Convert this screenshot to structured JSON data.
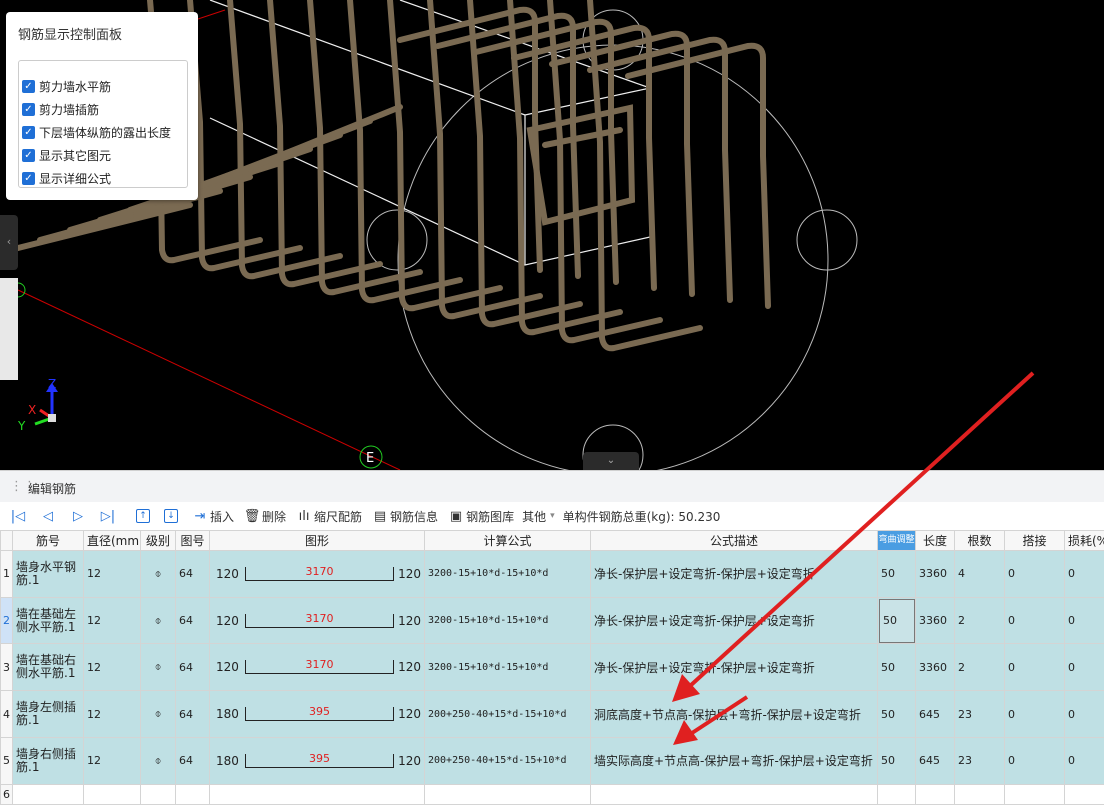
{
  "control_panel": {
    "title": "钢筋显示控制面板",
    "options": [
      {
        "label": "剪力墙水平筋",
        "checked": true
      },
      {
        "label": "剪力墙插筋",
        "checked": true
      },
      {
        "label": "下层墙体纵筋的露出长度",
        "checked": true
      },
      {
        "label": "显示其它图元",
        "checked": true
      },
      {
        "label": "显示详细公式",
        "checked": true
      }
    ]
  },
  "viewport": {
    "axis_z": "Z",
    "axis_x": "X",
    "axis_y": "Y",
    "marker_label": "E"
  },
  "editor": {
    "title": "编辑钢筋"
  },
  "toolbar": {
    "insert": "插入",
    "delete": "删除",
    "scale": "缩尺配筋",
    "rebar_info": "钢筋信息",
    "rebar_lib": "钢筋图库",
    "other": "其他",
    "total_weight": "单构件钢筋总重(kg): 50.230"
  },
  "table": {
    "headers": [
      "筋号",
      "直径(mm)",
      "级别",
      "图号",
      "图形",
      "计算公式",
      "公式描述",
      "弯曲调整",
      "长度",
      "根数",
      "搭接",
      "损耗(%"
    ],
    "highlighted_header": "弯曲调整",
    "rows": [
      {
        "num": "1",
        "name": "墙身水平钢筋.1",
        "dia": "12",
        "grade": "⌽",
        "fig": "64",
        "left": "120",
        "mid": "3170",
        "right": "120",
        "formula": "3200-15+10*d-15+10*d",
        "desc": "净长-保护层+设定弯折-保护层+设定弯折",
        "bend": "50",
        "len": "3360",
        "count": "4",
        "lap": "0",
        "loss": "0"
      },
      {
        "num": "2",
        "name": "墙在基础左侧水平筋.1",
        "dia": "12",
        "grade": "⌽",
        "fig": "64",
        "left": "120",
        "mid": "3170",
        "right": "120",
        "formula": "3200-15+10*d-15+10*d",
        "desc": "净长-保护层+设定弯折-保护层+设定弯折",
        "bend": "50",
        "len": "3360",
        "count": "2",
        "lap": "0",
        "loss": "0"
      },
      {
        "num": "3",
        "name": "墙在基础右侧水平筋.1",
        "dia": "12",
        "grade": "⌽",
        "fig": "64",
        "left": "120",
        "mid": "3170",
        "right": "120",
        "formula": "3200-15+10*d-15+10*d",
        "desc": "净长-保护层+设定弯折-保护层+设定弯折",
        "bend": "50",
        "len": "3360",
        "count": "2",
        "lap": "0",
        "loss": "0"
      },
      {
        "num": "4",
        "name": "墙身左侧插筋.1",
        "dia": "12",
        "grade": "⌽",
        "fig": "64",
        "left": "180",
        "mid": "395",
        "right": "120",
        "formula": "200+250-40+15*d-15+10*d",
        "desc": "洞底高度+节点高-保护层+弯折-保护层+设定弯折",
        "bend": "50",
        "len": "645",
        "count": "23",
        "lap": "0",
        "loss": "0"
      },
      {
        "num": "5",
        "name": "墙身右侧插筋.1",
        "dia": "12",
        "grade": "⌽",
        "fig": "64",
        "left": "180",
        "mid": "395",
        "right": "120",
        "formula": "200+250-40+15*d-15+10*d",
        "desc": "墙实际高度+节点高-保护层+弯折-保护层+设定弯折",
        "bend": "50",
        "len": "645",
        "count": "23",
        "lap": "0",
        "loss": "0"
      }
    ],
    "blank_row_num": "6"
  },
  "colors": {
    "accent": "#1f6fd6",
    "row_bg": "#bfe0e4",
    "viewport_bg": "#000000",
    "arrow": "#e02020"
  }
}
